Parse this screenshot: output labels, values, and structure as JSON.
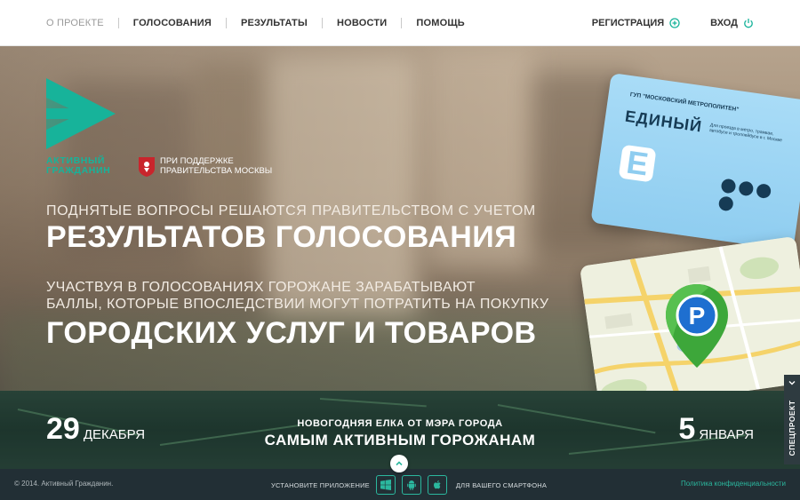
{
  "nav": {
    "items": [
      {
        "label": "О проекте",
        "active": true
      },
      {
        "label": "Голосования"
      },
      {
        "label": "Результаты"
      },
      {
        "label": "Новости"
      },
      {
        "label": "Помощь"
      }
    ],
    "register_label": "Регистрация",
    "login_label": "Вход",
    "icons": {
      "register": "plus-circle-icon",
      "login": "power-icon"
    }
  },
  "brand": {
    "name_line1": "Активный",
    "name_line2": "гражданин",
    "support_line1": "При поддержке",
    "support_line2": "Правительства Москвы",
    "accent_color": "#17b39a"
  },
  "hero": {
    "line1": "Поднятые вопросы решаются правительством с учетом",
    "line2": "результатов голосования",
    "line3a": "Участвуя в голосованиях горожане зарабатывают",
    "line3b": "баллы, которые впоследствии могут потратить на покупку",
    "line4": "городских услуг и товаров"
  },
  "ticket": {
    "org": "ГУП \"МОСКОВСКИЙ МЕТРОПОЛИТЕН\"",
    "title": "ЕДИНЫЙ",
    "letter": "Е",
    "note": "Для проезда в метро, трамвае, автобусе и троллейбусе в г. Москве"
  },
  "map_card": {
    "pin_letter": "P"
  },
  "promo": {
    "date_start_num": "29",
    "date_start_month": "декабря",
    "date_end_num": "5",
    "date_end_month": "января",
    "subtitle": "Новогодняя елка от мэра города",
    "title": "Самым активным горожанам"
  },
  "side_tab": {
    "label": "Спецпроект"
  },
  "footer": {
    "copyright": "© 2014. Активный Гражданин.",
    "install_label": "Установите приложение",
    "smartphone_label": "для вашего смартфона",
    "stores": [
      "windows-icon",
      "android-icon",
      "apple-icon"
    ],
    "privacy_label": "Политика конфиденциальности"
  }
}
